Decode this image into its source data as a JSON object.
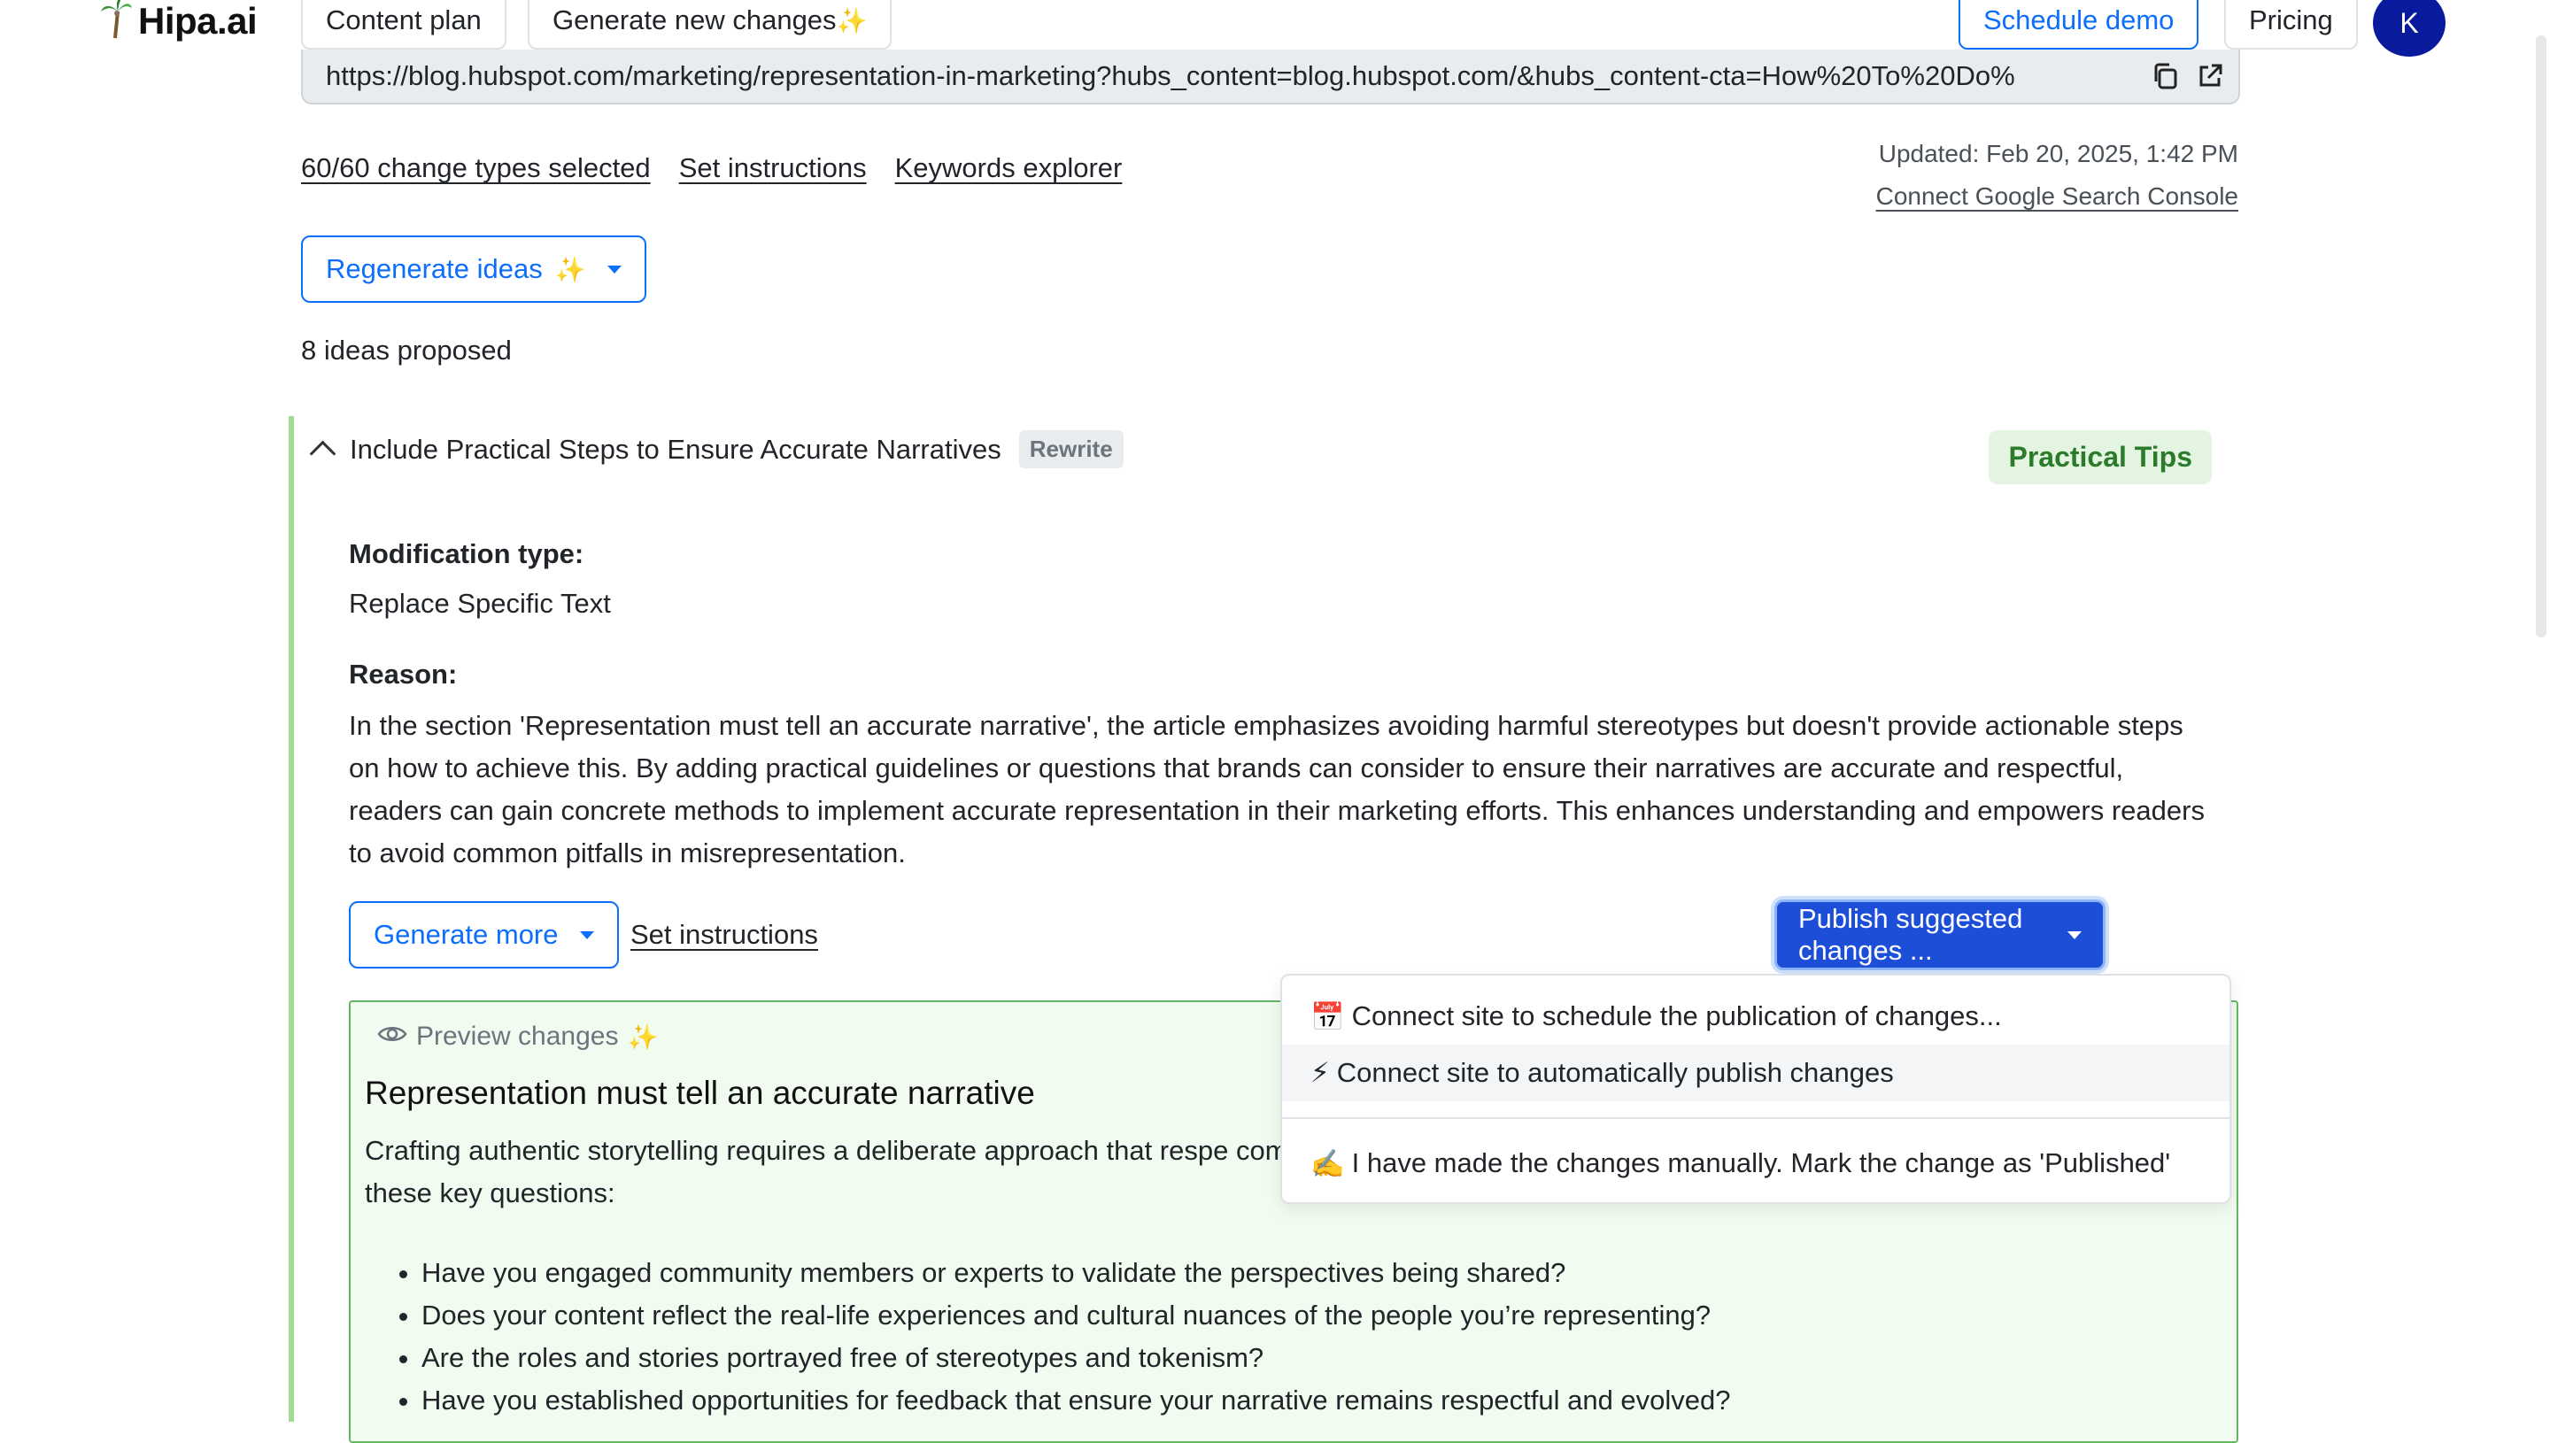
{
  "nav": {
    "logo_text": "Hipa.ai",
    "content_plan": "Content plan",
    "generate_new_changes": "Generate new changes",
    "schedule_demo": "Schedule demo",
    "pricing": "Pricing",
    "avatar_initial": "K"
  },
  "url_bar": {
    "url": "https://blog.hubspot.com/marketing/representation-in-marketing?hubs_content=blog.hubspot.com/&hubs_content-cta=How%20To%20Do%"
  },
  "meta": {
    "change_types": "60/60 change types selected",
    "set_instructions": "Set instructions",
    "keywords_explorer": "Keywords explorer",
    "updated": "Updated: Feb 20, 2025, 1:42 PM",
    "connect_gsc": "Connect Google Search Console"
  },
  "regenerate_label": "Regenerate ideas",
  "ideas_proposed": "8 ideas proposed",
  "idea": {
    "title": "Include Practical Steps to Ensure Accurate Narratives",
    "badge": "Rewrite",
    "category": "Practical Tips",
    "modification_label": "Modification type:",
    "modification_value": "Replace Specific Text",
    "reason_label": "Reason:",
    "reason_text": "In the section 'Representation must tell an accurate narrative', the article emphasizes avoiding harmful stereotypes but doesn't provide actionable steps on how to achieve this. By adding practical guidelines or questions that brands can consider to ensure their narratives are accurate and respectful, readers can gain concrete methods to implement accurate representation in their marketing efforts. This enhances understanding and empowers readers to avoid common pitfalls in misrepresentation.",
    "generate_more": "Generate more",
    "set_instructions": "Set instructions",
    "publish_button": "Publish suggested changes ..."
  },
  "preview": {
    "label": "Preview changes",
    "title": "Representation must tell an accurate narrative",
    "paragraph": "Crafting authentic storytelling requires a deliberate approach that respe communities, ask yourself these key questions:",
    "bullets": [
      "Have you engaged community members or experts to validate the perspectives being shared?",
      "Does your content reflect the real-life experiences and cultural nuances of the people you’re representing?",
      "Are the roles and stories portrayed free of stereotypes and tokenism?",
      "Have you established opportunities for feedback that ensure your narrative remains respectful and evolved?"
    ]
  },
  "dropdown": {
    "items": [
      {
        "icon": "📅",
        "label": "Connect site to schedule the publication of changes..."
      },
      {
        "icon": "⚡",
        "label": "Connect site to automatically publish changes"
      },
      {
        "icon": "✍️",
        "label": "I have made the changes manually. Mark the change as 'Published'"
      }
    ]
  },
  "colors": {
    "primary": "#0d6efd",
    "publish": "#1d4ed8",
    "idea_border": "#9fdc94",
    "preview_bg": "#f1fbef",
    "tips_bg": "#e3f4e0",
    "avatar": "#0a1a9c"
  }
}
